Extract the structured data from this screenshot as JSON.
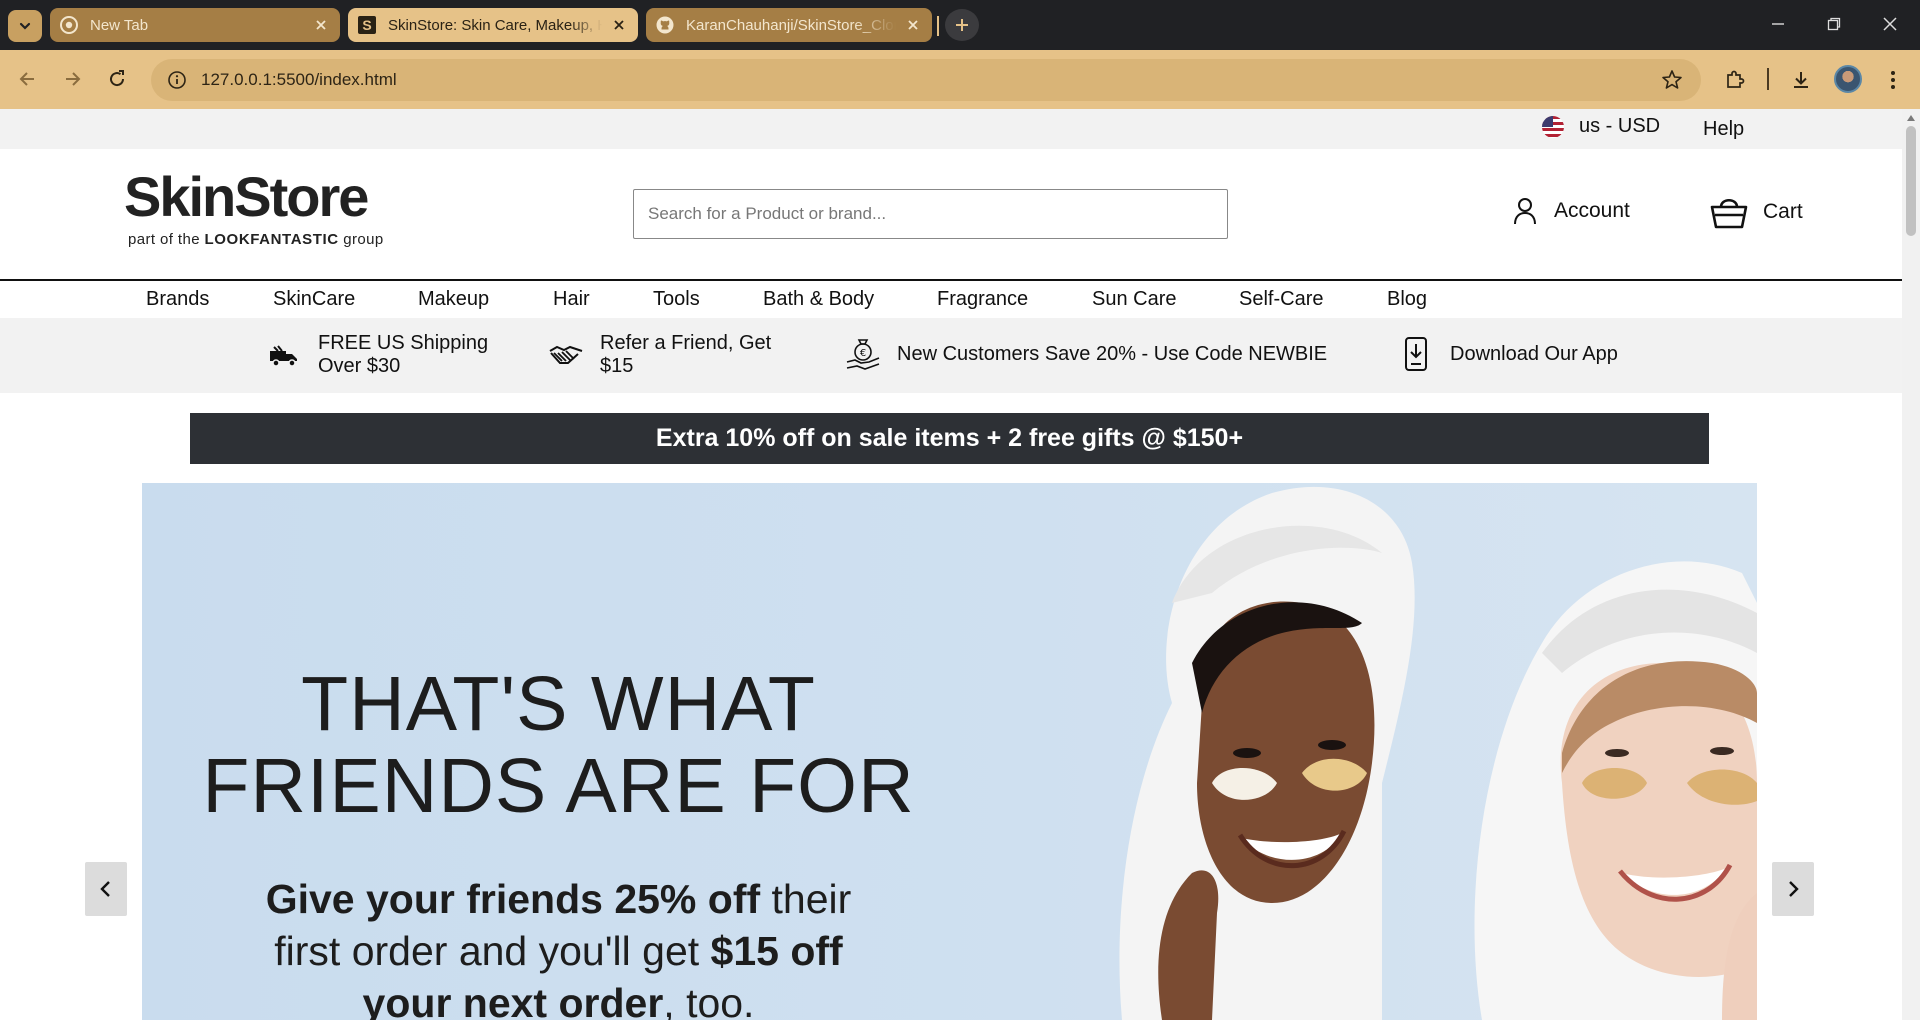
{
  "browser": {
    "tabs": [
      {
        "title": "New Tab",
        "state": "inactive"
      },
      {
        "title": "SkinStore: Skin Care, Makeup, Hair",
        "state": "active"
      },
      {
        "title": "KaranChauhanji/SkinStore_Clone",
        "state": "inactive"
      }
    ],
    "url": "127.0.0.1:5500/index.html"
  },
  "site": {
    "locale": "us - USD",
    "help": "Help",
    "logo": {
      "name": "SkinStore",
      "sub_prefix": "part of the ",
      "sub_brand": "LOOKFANTASTIC",
      "sub_suffix": " group"
    },
    "search_placeholder": "Search for a Product or brand...",
    "account_label": "Account",
    "cart_label": "Cart",
    "categories": [
      "Brands",
      "SkinCare",
      "Makeup",
      "Hair",
      "Tools",
      "Bath & Body",
      "Fragrance",
      "Sun Care",
      "Self-Care",
      "Blog"
    ],
    "benefits": [
      {
        "icon": "truck-icon",
        "line1": "FREE US Shipping",
        "line2": "Over $30"
      },
      {
        "icon": "handshake-icon",
        "line1": "Refer a Friend, Get",
        "line2": "$15"
      },
      {
        "icon": "money-hand-icon",
        "line1": "New Customers Save 20% - Use Code NEWBIE",
        "line2": ""
      },
      {
        "icon": "phone-download-icon",
        "line1": "Download Our App",
        "line2": ""
      }
    ],
    "promo_banner": "Extra 10% off on sale items + 2 free gifts @ $150+",
    "hero": {
      "heading_line1": "THAT'S WHAT",
      "heading_line2": "FRIENDS ARE FOR",
      "body": {
        "b1": "Give your friends 25% off",
        "t1": " their",
        "t2": "first order and you'll get ",
        "b2": "$15 off",
        "b3": "your next order",
        "t3": ", too."
      }
    }
  },
  "colors": {
    "chrome_dark": "#202124",
    "chrome_accent": "#e6c288",
    "promo_bg": "#2d3035",
    "hero_bg": "#cfe0f0"
  }
}
